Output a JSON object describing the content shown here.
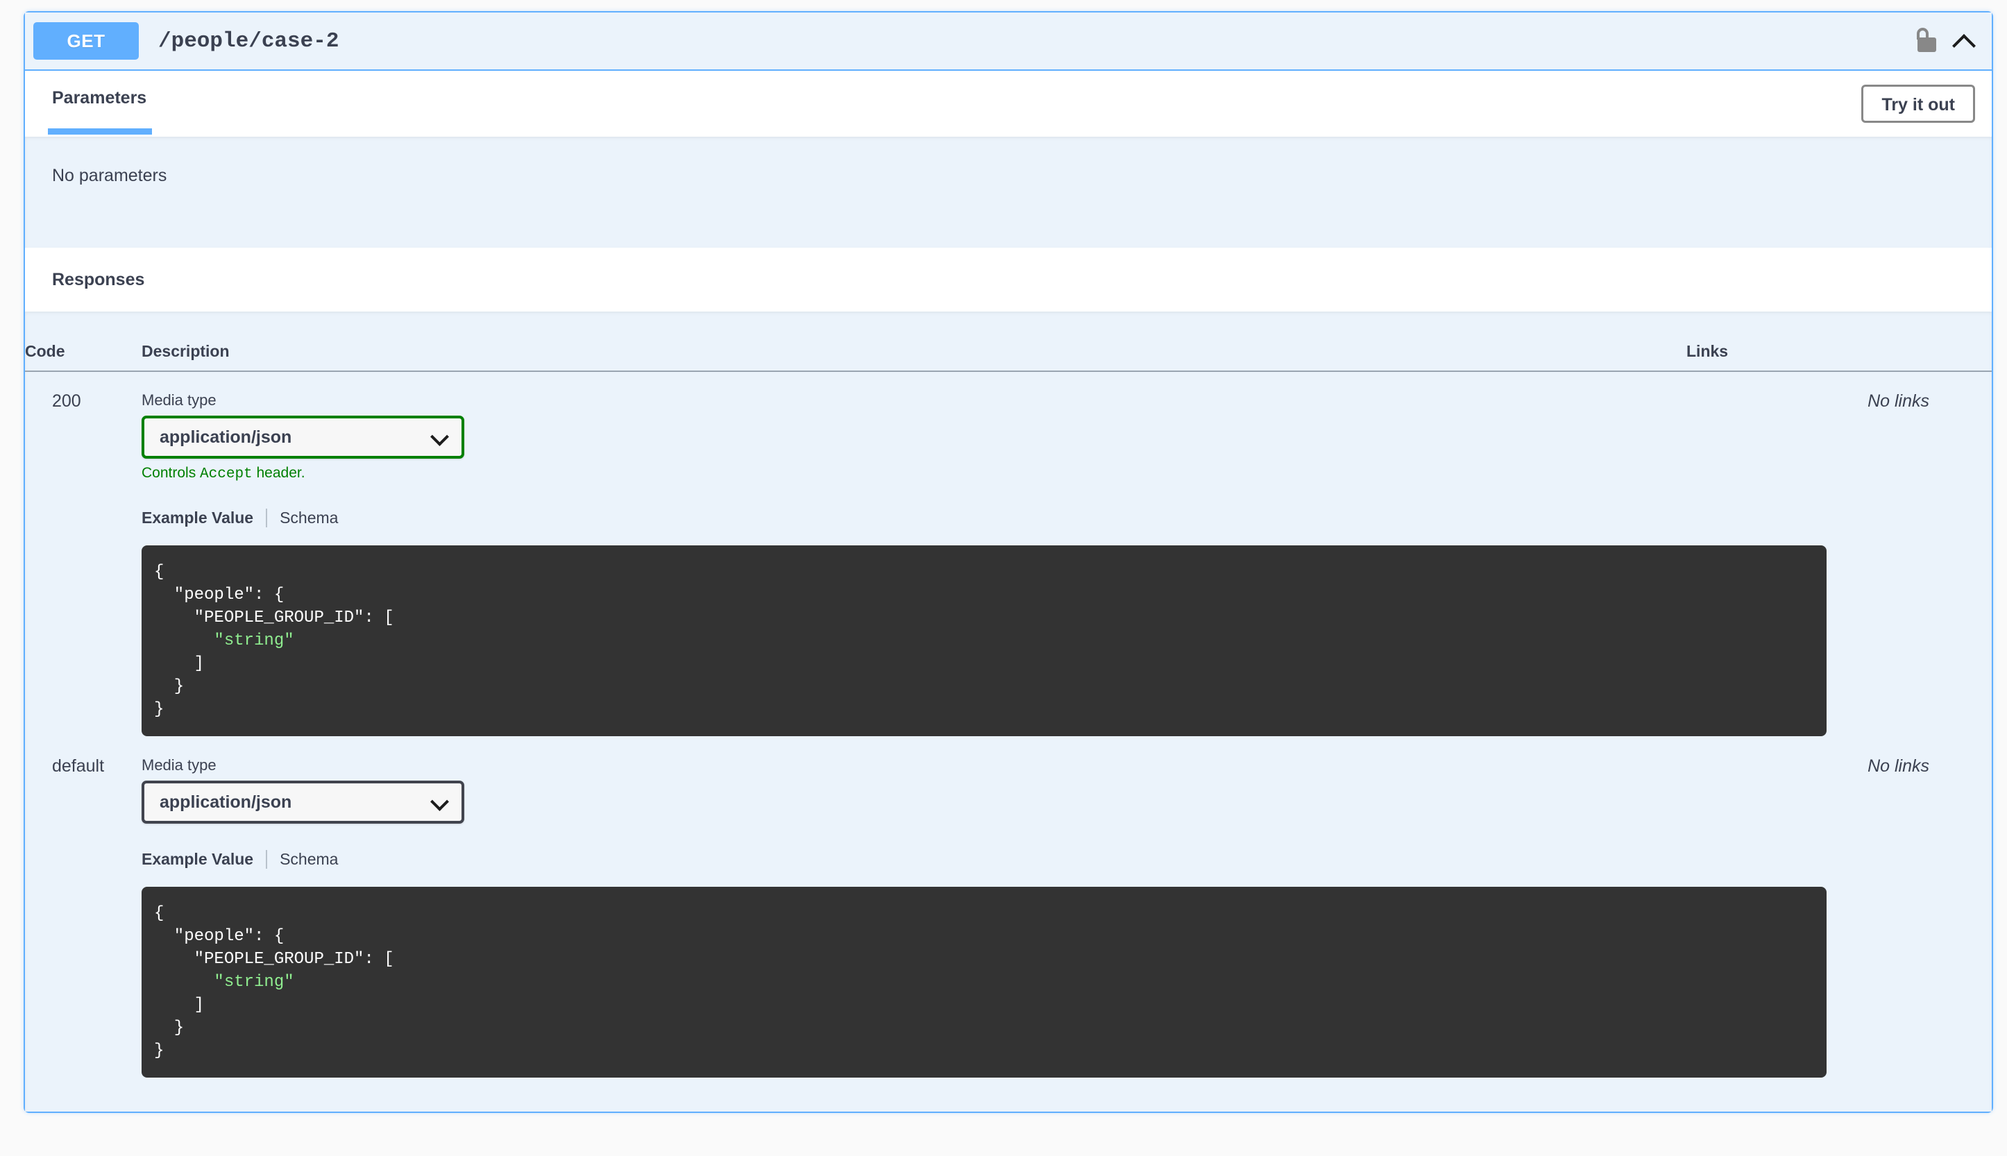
{
  "operation": {
    "method": "GET",
    "path": "/people/case-2",
    "lock_icon": "unlocked-padlock-icon",
    "collapse_icon": "chevron-up-icon"
  },
  "tabs": [
    {
      "label": "Parameters",
      "active": true
    }
  ],
  "try_it_out_label": "Try it out",
  "parameters": {
    "empty_text": "No parameters"
  },
  "responses": {
    "title": "Responses",
    "columns": {
      "code": "Code",
      "description": "Description",
      "links": "Links"
    },
    "rows": [
      {
        "code": "200",
        "media_label": "Media type",
        "media_value": "application/json",
        "media_border_color": "#008000",
        "accept_note_prefix": "Controls ",
        "accept_note_code": "Accept",
        "accept_note_suffix": " header.",
        "example_tab": "Example Value",
        "schema_tab": "Schema",
        "example_json_lines": [
          {
            "text": "{",
            "type": "plain"
          },
          {
            "text": "  \"people\": {",
            "type": "plain"
          },
          {
            "text": "    \"PEOPLE_GROUP_ID\": [",
            "type": "plain"
          },
          {
            "text": "      \"string\"",
            "type": "string"
          },
          {
            "text": "    ]",
            "type": "plain"
          },
          {
            "text": "  }",
            "type": "plain"
          },
          {
            "text": "}",
            "type": "plain"
          }
        ],
        "links": "No links"
      },
      {
        "code": "default",
        "media_label": "Media type",
        "media_value": "application/json",
        "media_border_color": "#41444e",
        "accept_note_prefix": "",
        "accept_note_code": "",
        "accept_note_suffix": "",
        "example_tab": "Example Value",
        "schema_tab": "Schema",
        "example_json_lines": [
          {
            "text": "{",
            "type": "plain"
          },
          {
            "text": "  \"people\": {",
            "type": "plain"
          },
          {
            "text": "    \"PEOPLE_GROUP_ID\": [",
            "type": "plain"
          },
          {
            "text": "      \"string\"",
            "type": "string"
          },
          {
            "text": "    ]",
            "type": "plain"
          },
          {
            "text": "  }",
            "type": "plain"
          },
          {
            "text": "}",
            "type": "plain"
          }
        ],
        "links": "No links"
      }
    ]
  },
  "colors": {
    "method_get": "#61affe",
    "block_border": "#61affe",
    "block_background": "#ebf3fb",
    "accent_green": "#008000",
    "code_background": "#333333",
    "code_string": "#90ee90",
    "text": "#3b4151"
  }
}
